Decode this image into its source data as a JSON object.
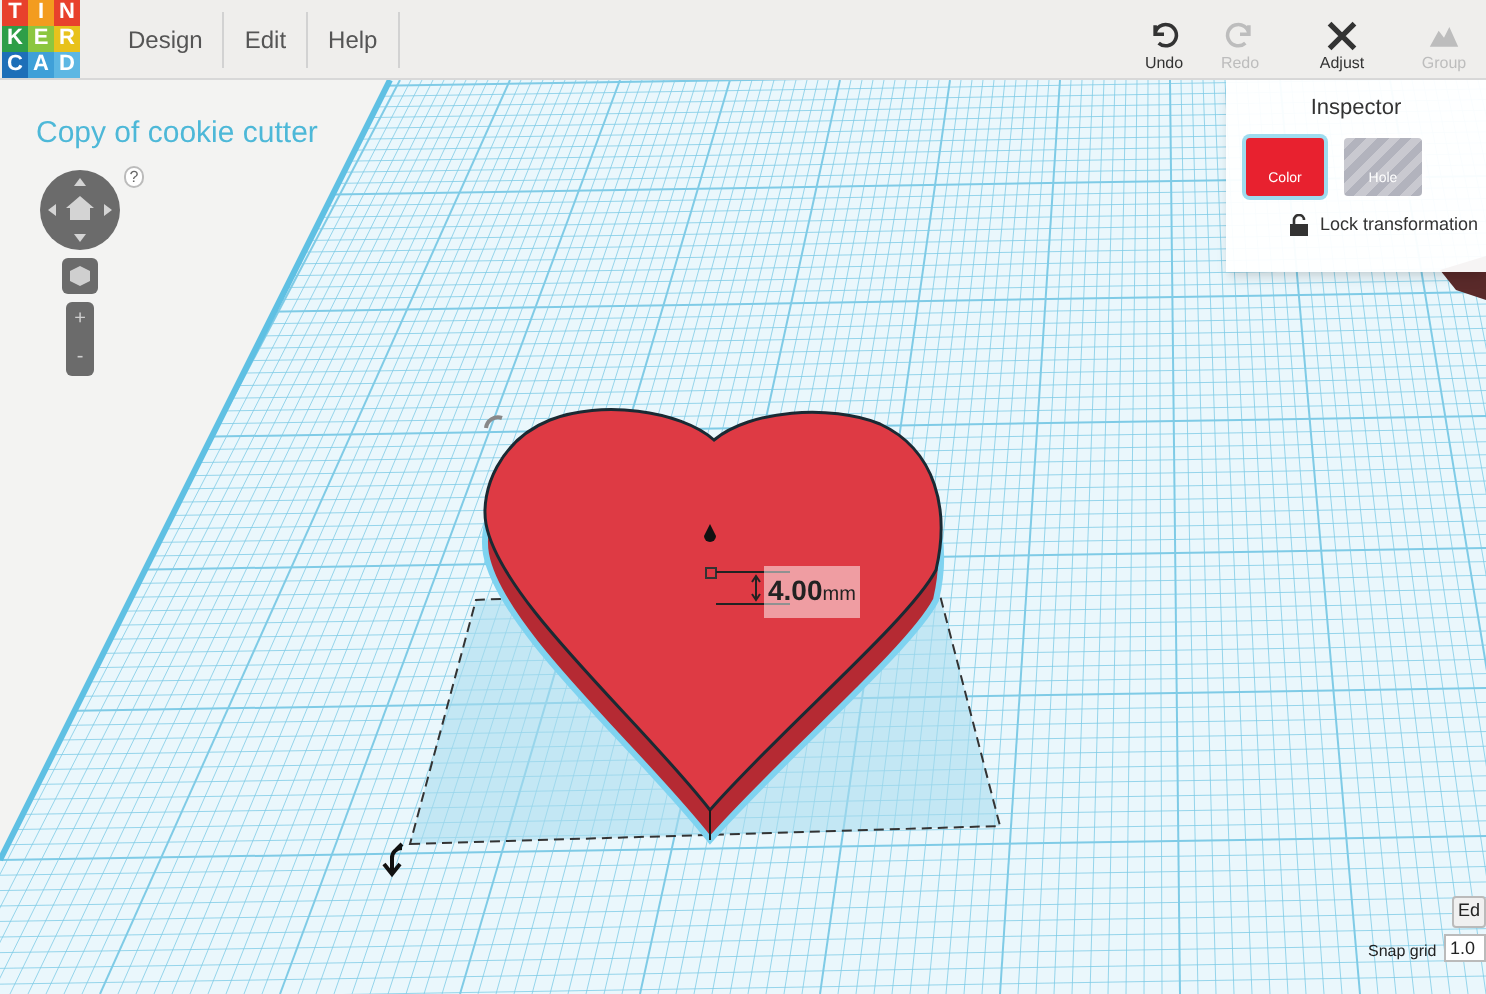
{
  "logo_letters": [
    {
      "letter": "T",
      "color": "#e8412c"
    },
    {
      "letter": "I",
      "color": "#f39c1f"
    },
    {
      "letter": "N",
      "color": "#e8412c"
    },
    {
      "letter": "K",
      "color": "#2e9e48"
    },
    {
      "letter": "E",
      "color": "#8cc63f"
    },
    {
      "letter": "R",
      "color": "#e8c21c"
    },
    {
      "letter": "C",
      "color": "#1d6fb8"
    },
    {
      "letter": "A",
      "color": "#3fa0d8"
    },
    {
      "letter": "D",
      "color": "#5db7e3"
    }
  ],
  "menu": [
    {
      "label": "Design"
    },
    {
      "label": "Edit"
    },
    {
      "label": "Help"
    }
  ],
  "toolbar": [
    {
      "label": "Undo",
      "kind": "undo",
      "disabled": false
    },
    {
      "label": "Redo",
      "kind": "redo",
      "disabled": true
    },
    {
      "label": "Adjust",
      "kind": "adjust",
      "disabled": false
    },
    {
      "label": "Group",
      "kind": "group",
      "disabled": true
    }
  ],
  "title": "Copy of cookie cutter",
  "nav": {
    "help": "?",
    "zoom_in": "+",
    "zoom_out": "-"
  },
  "inspector": {
    "title": "Inspector",
    "swatches": [
      {
        "label": "Color",
        "kind": "color",
        "selected": true
      },
      {
        "label": "Hole",
        "kind": "hole",
        "selected": false
      }
    ],
    "lock_label": "Lock transformation"
  },
  "shape": {
    "height_value": "4.00",
    "height_unit": "mm"
  },
  "snap": {
    "edit_button": "Ed",
    "label": "Snap grid",
    "value": "1.0"
  }
}
